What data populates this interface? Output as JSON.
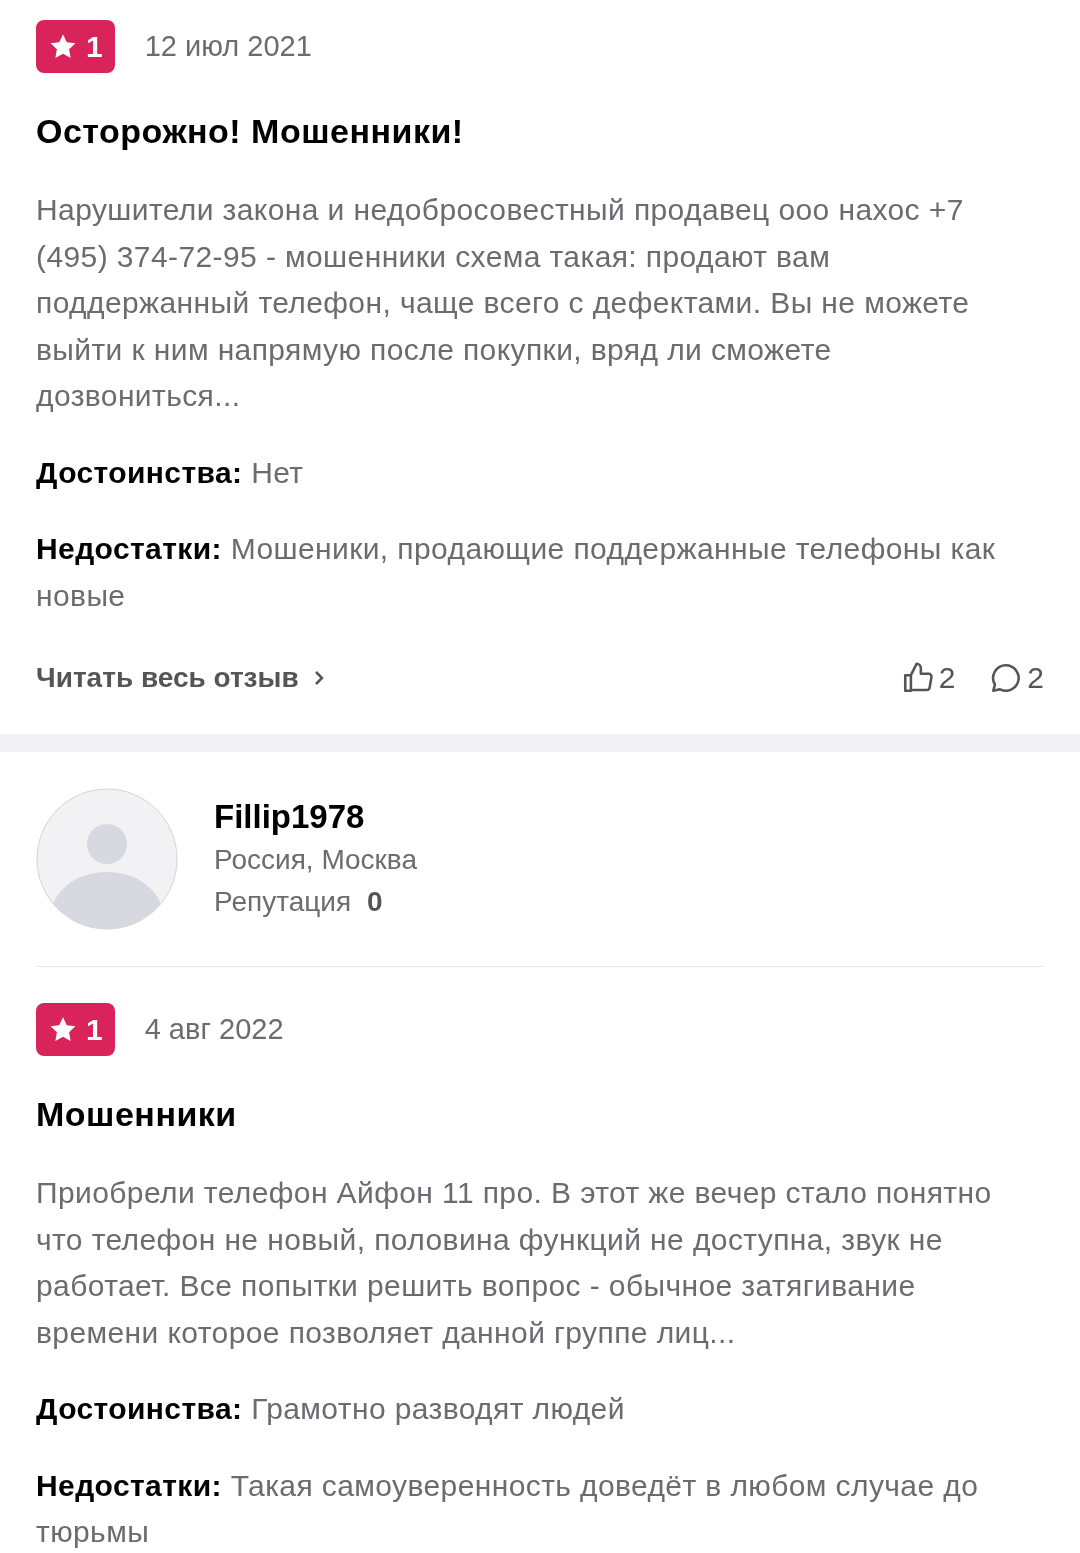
{
  "reviews": [
    {
      "rating": "1",
      "date": "12 июл 2021",
      "title": "Осторожно! Мошенники!",
      "body": "Нарушители закона и недобросовестный продавец ооо нахос +7 (495) 374-72-95 - мошенники схема такая: продают вам поддержанный телефон, чаще всего с дефектами. Вы не можете выйти к ним напрямую после покупки, вряд ли сможете дозвониться...",
      "pros_label": "Достоинства:",
      "pros": "Нет",
      "cons_label": "Недостатки:",
      "cons": "Мошеники, продающие поддержанные телефоны как новые",
      "read_more": "Читать весь отзыв",
      "likes": "2",
      "comments": "2"
    },
    {
      "author": {
        "name": "Fillip1978",
        "location": "Россия, Москва",
        "reputation_label": "Репутация",
        "reputation": "0"
      },
      "rating": "1",
      "date": "4 авг 2022",
      "title": "Мошенники",
      "body": "Приобрели телефон Айфон 11 про. В этот же вечер стало понятно что телефон не новый, половина функций не доступна, звук не работает. Все попытки решить вопрос - обычное затягивание времени которое позволяет данной группе лиц...",
      "pros_label": "Достоинства:",
      "pros": "Грамотно разводят людей",
      "cons_label": "Недостатки:",
      "cons": "Такая самоуверенность доведёт в любом случае до тюрьмы"
    }
  ]
}
